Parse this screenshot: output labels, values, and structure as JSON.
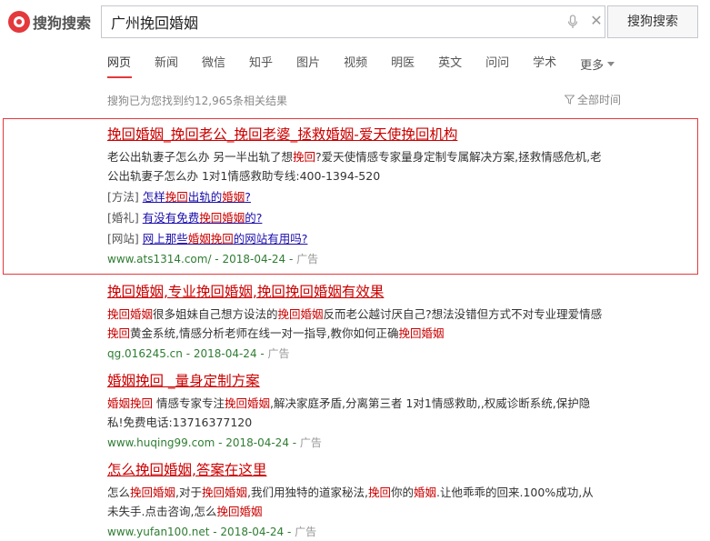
{
  "header": {
    "logo_text": "搜狗搜索",
    "search_value": "广州挽回婚姻",
    "search_button": "搜狗搜索"
  },
  "tabs": [
    {
      "label": "网页",
      "active": true
    },
    {
      "label": "新闻"
    },
    {
      "label": "微信"
    },
    {
      "label": "知乎"
    },
    {
      "label": "图片"
    },
    {
      "label": "视频"
    },
    {
      "label": "明医"
    },
    {
      "label": "英文"
    },
    {
      "label": "问问"
    },
    {
      "label": "学术"
    }
  ],
  "more_label": "更多",
  "result_count": "搜狗已为您找到约12,965条相关结果",
  "filter_label": "全部时间",
  "results": [
    {
      "title": "挽回婚姻_挽回老公_挽回老婆_拯救婚姻-爱天使挽回机构",
      "desc_parts": [
        {
          "t": "老公出轨妻子怎么办 另一半出轨了想"
        },
        {
          "t": "挽回",
          "hl": true
        },
        {
          "t": "?爱天使情感专家量身定制专属解决方案,拯救情感危机,老公出轨妻子怎么办 1对1情感救助专线:400-1394-520"
        }
      ],
      "sublinks": [
        {
          "tag": "[方法]",
          "parts": [
            {
              "t": "怎样"
            },
            {
              "t": "挽回",
              "hl": true
            },
            {
              "t": "出轨的"
            },
            {
              "t": "婚姻",
              "hl": true
            },
            {
              "t": "?"
            }
          ]
        },
        {
          "tag": "[婚礼]",
          "parts": [
            {
              "t": "有没有免费"
            },
            {
              "t": "挽回婚姻",
              "hl": true
            },
            {
              "t": "的?"
            }
          ]
        },
        {
          "tag": "[网站]",
          "parts": [
            {
              "t": "网上那些"
            },
            {
              "t": "婚姻挽回",
              "hl": true
            },
            {
              "t": "的网站有用吗?"
            }
          ]
        }
      ],
      "url": "www.ats1314.com/ - 2018-04-24",
      "ad": "广告"
    },
    {
      "title": "挽回婚姻,专业挽回婚姻,挽回挽回婚姻有效果",
      "desc_parts": [
        {
          "t": "挽回婚姻",
          "hl": true
        },
        {
          "t": "很多姐妹自己想方设法的"
        },
        {
          "t": "挽回婚姻",
          "hl": true
        },
        {
          "t": "反而老公越讨厌自己?想法没错但方式不对专业理爱情感"
        },
        {
          "t": "挽回",
          "hl": true
        },
        {
          "t": "黄金系统,情感分析老师在线一对一指导,教你如何正确"
        },
        {
          "t": "挽回婚姻",
          "hl": true
        }
      ],
      "url": "qg.016245.cn - 2018-04-24",
      "ad": "广告"
    },
    {
      "title": "婚姻挽回 _量身定制方案",
      "desc_parts": [
        {
          "t": "婚姻挽回",
          "hl": true
        },
        {
          "t": " 情感专家专注"
        },
        {
          "t": "挽回婚姻",
          "hl": true
        },
        {
          "t": ",解决家庭矛盾,分离第三者 1对1情感救助,,权威诊断系统,保护隐私!免费电话:13716377120"
        }
      ],
      "url": "www.huqing99.com - 2018-04-24",
      "ad": "广告"
    },
    {
      "title": "怎么挽回婚姻,答案在这里",
      "desc_parts": [
        {
          "t": "怎么"
        },
        {
          "t": "挽回婚姻",
          "hl": true
        },
        {
          "t": ",对于"
        },
        {
          "t": "挽回婚姻",
          "hl": true
        },
        {
          "t": ",我们用独特的道家秘法,"
        },
        {
          "t": "挽回",
          "hl": true
        },
        {
          "t": "你的"
        },
        {
          "t": "婚姻",
          "hl": true
        },
        {
          "t": ".让他乖乖的回来.100%成功,从未失手.点击咨询,怎么"
        },
        {
          "t": "挽回婚姻",
          "hl": true
        }
      ],
      "url": "www.yufan100.net - 2018-04-24",
      "ad": "广告"
    }
  ]
}
